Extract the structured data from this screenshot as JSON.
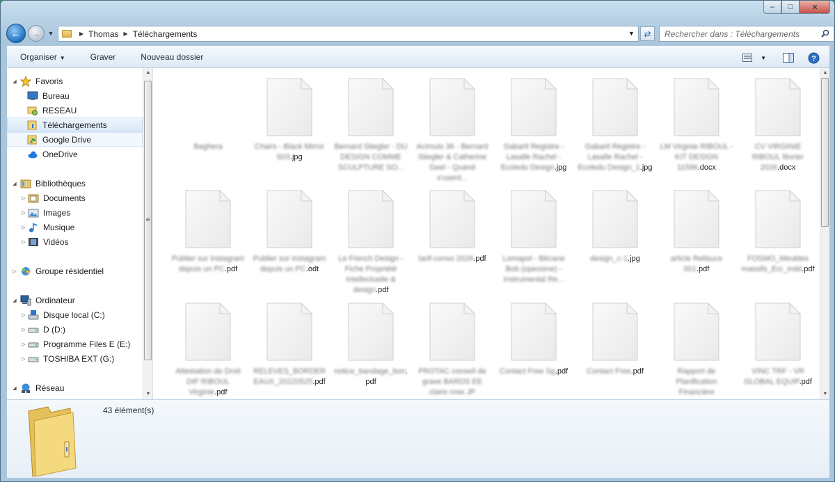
{
  "nav": {
    "breadcrumbs": [
      "Thomas",
      "Téléchargements"
    ],
    "search_placeholder": "Rechercher dans : Téléchargements"
  },
  "toolbar": {
    "organise": "Organiser",
    "burn": "Graver",
    "new_folder": "Nouveau dossier"
  },
  "sidebar": {
    "favorites": "Favoris",
    "desktop": "Bureau",
    "network_fav": "RESEAU",
    "downloads": "Téléchargements",
    "google_drive": "Google Drive",
    "onedrive": "OneDrive",
    "libraries": "Bibliothèques",
    "documents": "Documents",
    "images": "Images",
    "music": "Musique",
    "videos": "Vidéos",
    "homegroup": "Groupe résidentiel",
    "computer": "Ordinateur",
    "drive_c": "Disque local (C:)",
    "drive_d": "D (D:)",
    "drive_e": "Programme Files E (E:)",
    "drive_g": "TOSHIBA EXT (G:)",
    "network": "Réseau"
  },
  "files": [
    {
      "blur": "Baghera",
      "ext": "",
      "icon": false
    },
    {
      "blur": "Chairs - Black Mirror S03",
      "ext": ".jpg",
      "icon": true
    },
    {
      "blur": "Bernard Stiegler - DU DESIGN COMME SCULPTURE SO...",
      "ext": "",
      "icon": true
    },
    {
      "blur": "Acimuts 36 - Bernard Stiegler & Catherine Geel - Quand s'usent...",
      "ext": "",
      "icon": true
    },
    {
      "blur": "Gabarit Registre - Lasalle Rachel - Ecoledu Design",
      "ext": ".jpg",
      "icon": true
    },
    {
      "blur": "Gabarit Registre - Lasalle Rachel - Ecoledu Design_1",
      "ext": ".jpg",
      "icon": true
    },
    {
      "blur": "LM Virginie RIBOUL - KIT DESIGN 11596",
      "ext": ".docx",
      "icon": true
    },
    {
      "blur": "CV VIRGINIE RIBOUL février 2026",
      "ext": ".docx",
      "icon": true
    },
    {
      "blur": "Publier sur Instagram depuis un PC",
      "ext": ".pdf",
      "icon": true
    },
    {
      "blur": "Publier sur Instagram depuis un PC",
      "ext": ".odt",
      "icon": true
    },
    {
      "blur": "Le French Design - Fiche Propriété Intellectuelle & design",
      "ext": ".pdf",
      "icon": true
    },
    {
      "blur": "tarif-conso 2026",
      "ext": ".pdf",
      "icon": true
    },
    {
      "blur": "Lomapol - Bécane Bob (opessine) - Instrumental Re...",
      "ext": "",
      "icon": true
    },
    {
      "blur": "design_c-1",
      "ext": ".jpg",
      "icon": true
    },
    {
      "blur": "article Relisuce 001",
      "ext": ".pdf",
      "icon": true
    },
    {
      "blur": "FOSMO_Meubles massifs_Ecr_indd",
      "ext": ".pdf",
      "icon": true
    },
    {
      "blur": "Attestation de Droit DIF RIBOUL Virginie",
      "ext": ".pdf",
      "icon": true
    },
    {
      "blur": "RELEVES_BORDEREAUX_20220525",
      "ext": ".pdf",
      "icon": true
    },
    {
      "blur": "notice_bandage_bon",
      "ext": ".pdf",
      "icon": true
    },
    {
      "blur": "PROTAC conseil de grave BARDS EE claire rose JP",
      "ext": "",
      "icon": true
    },
    {
      "blur": "Contact Free Sg",
      "ext": ".pdf",
      "icon": true
    },
    {
      "blur": "Contact Free",
      "ext": ".pdf",
      "icon": true
    },
    {
      "blur": "Rapport de Planification Financière",
      "ext": "",
      "icon": true
    },
    {
      "blur": "VINC TRF - VR GLOBAL EQUIP",
      "ext": ".pdf",
      "icon": true
    }
  ],
  "details": {
    "count": "43 élément(s)"
  }
}
